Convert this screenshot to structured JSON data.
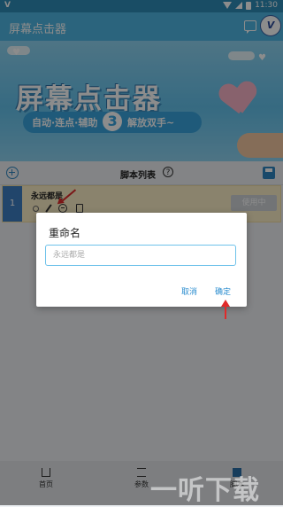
{
  "status_bar": {
    "carrier_badge": "V",
    "time": "11:30"
  },
  "app_bar": {
    "title": "屏幕点击器",
    "logo_text": "V"
  },
  "banner": {
    "title": "屏幕点击器",
    "pill_left": "自动·连点·辅助",
    "pill_number": "3",
    "pill_right": "解放双手~"
  },
  "toolbar": {
    "title": "脚本列表",
    "help_symbol": "?"
  },
  "script_list": [
    {
      "index": "1",
      "name": "永远都是",
      "status_label": "使用中"
    }
  ],
  "dialog": {
    "title": "重命名",
    "input_placeholder": "永远都是",
    "input_value": "",
    "cancel_label": "取消",
    "confirm_label": "确定"
  },
  "bottom_nav": [
    {
      "label": "首页"
    },
    {
      "label": "参数"
    },
    {
      "label": "脚本"
    }
  ],
  "watermark": "一听下载",
  "colors": {
    "app_bar": "#4fb6e3",
    "accent": "#2e86c1",
    "row_highlight": "#fbefc7",
    "annotation_arrow": "#e12a2a"
  }
}
